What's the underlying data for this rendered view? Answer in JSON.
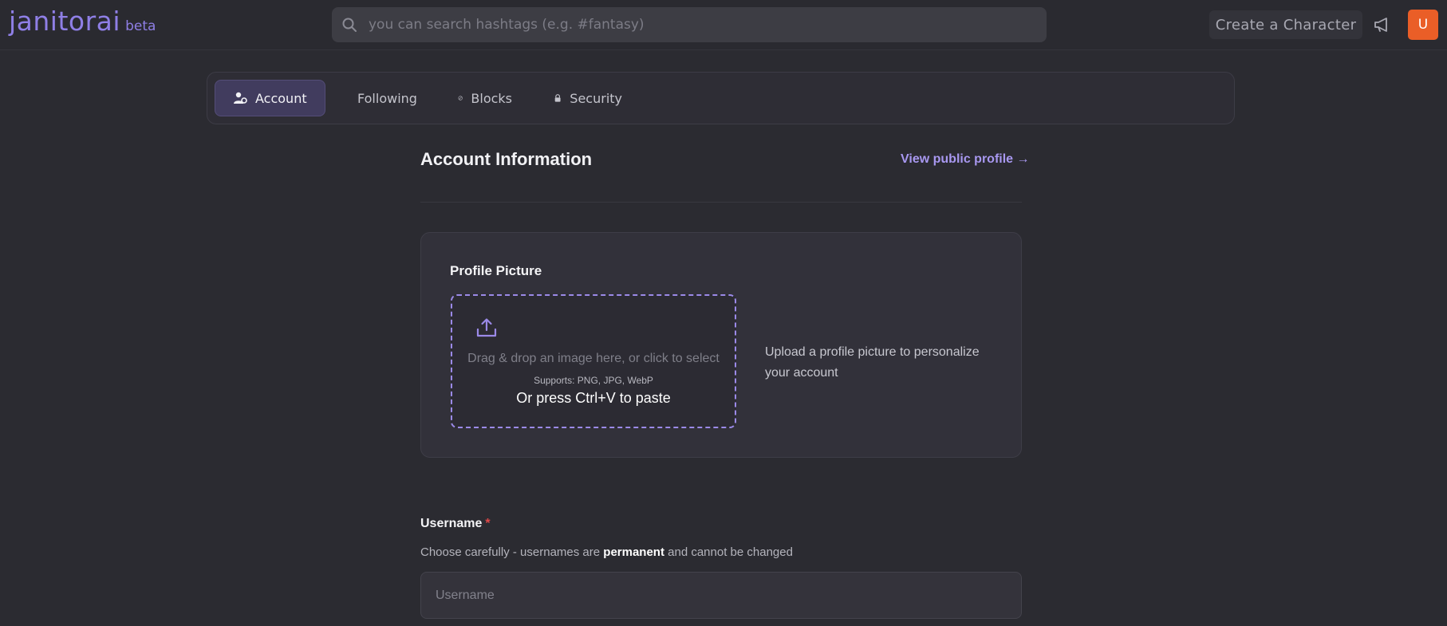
{
  "header": {
    "logo_text": "janitorai",
    "logo_badge": "beta",
    "search_placeholder": "you can search hashtags (e.g. #fantasy)",
    "create_label": "Create a Character",
    "avatar_initial": "U",
    "avatar_color": "#ea5e27"
  },
  "tabs": [
    {
      "label": "Account",
      "icon": "user-gear-icon",
      "active": true
    },
    {
      "label": "Following",
      "icon": "users-icon",
      "active": false
    },
    {
      "label": "Blocks",
      "icon": "block-icon",
      "active": false
    },
    {
      "label": "Security",
      "icon": "lock-icon",
      "active": false
    }
  ],
  "account": {
    "title": "Account Information",
    "profile_link": "View public profile →"
  },
  "profile_picture": {
    "title": "Profile Picture",
    "drop_text": "Drag & drop an image here, or click to select",
    "supports": "Supports: PNG, JPG, WebP",
    "paste_hint": "Or press Ctrl+V to paste",
    "description": "Upload a profile picture to personalize your account"
  },
  "username": {
    "label": "Username",
    "required_mark": "*",
    "help_before": "Choose carefully - usernames are ",
    "help_bold": "permanent",
    "help_after": " and cannot be changed",
    "placeholder": "Username",
    "value": ""
  },
  "colors": {
    "accent": "#8f7fe6",
    "background": "#2b2b31"
  }
}
